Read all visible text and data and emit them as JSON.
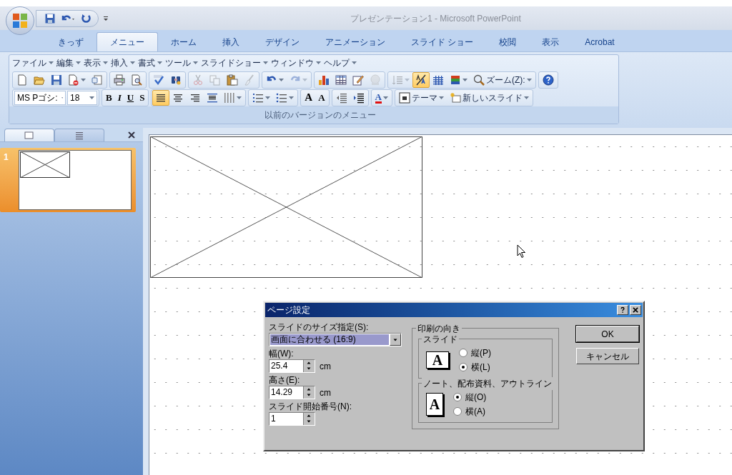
{
  "window": {
    "title": "プレゼンテーション1 - Microsoft PowerPoint"
  },
  "tabs": [
    {
      "label": "きっず",
      "selected": false
    },
    {
      "label": "メニュー",
      "selected": true
    },
    {
      "label": "ホーム",
      "selected": false
    },
    {
      "label": "挿入",
      "selected": false
    },
    {
      "label": "デザイン",
      "selected": false
    },
    {
      "label": "アニメーション",
      "selected": false
    },
    {
      "label": "スライド ショー",
      "selected": false
    },
    {
      "label": "校閲",
      "selected": false
    },
    {
      "label": "表示",
      "selected": false
    },
    {
      "label": "Acrobat",
      "selected": false
    }
  ],
  "classic_menu": {
    "menu_items": [
      "ファイル",
      "編集",
      "表示",
      "挿入",
      "書式",
      "ツール",
      "スライドショー",
      "ウィンドウ",
      "ヘルプ"
    ],
    "standard_toolbar": [
      [
        {
          "kind": "icon",
          "selected": false,
          "disabled": false,
          "dropdown": false
        },
        {
          "kind": "icon",
          "selected": false,
          "disabled": false,
          "dropdown": false
        },
        {
          "kind": "icon",
          "selected": false,
          "disabled": false,
          "dropdown": false
        },
        {
          "kind": "icon",
          "selected": false,
          "disabled": false,
          "dropdown": true
        },
        {
          "kind": "icon",
          "selected": false,
          "disabled": false,
          "dropdown": false
        }
      ],
      [
        {
          "kind": "icon",
          "selected": false,
          "disabled": false,
          "dropdown": false
        },
        {
          "kind": "icon",
          "selected": false,
          "disabled": false,
          "dropdown": false
        }
      ],
      [
        {
          "kind": "icon",
          "selected": false,
          "disabled": false,
          "dropdown": false
        },
        {
          "kind": "icon",
          "selected": false,
          "disabled": false,
          "dropdown": false
        }
      ],
      [
        {
          "kind": "icon",
          "selected": false,
          "disabled": true,
          "dropdown": false
        },
        {
          "kind": "icon",
          "selected": false,
          "disabled": true,
          "dropdown": false
        },
        {
          "kind": "icon",
          "selected": false,
          "disabled": false,
          "dropdown": false
        },
        {
          "kind": "icon",
          "selected": false,
          "disabled": true,
          "dropdown": false
        }
      ],
      [
        {
          "kind": "icon",
          "selected": false,
          "disabled": false,
          "dropdown": true
        },
        {
          "kind": "icon",
          "selected": false,
          "disabled": true,
          "dropdown": true
        }
      ],
      [
        {
          "kind": "icon",
          "selected": false,
          "disabled": false,
          "dropdown": false
        },
        {
          "kind": "icon",
          "selected": false,
          "disabled": false,
          "dropdown": false
        },
        {
          "kind": "icon",
          "selected": false,
          "disabled": false,
          "dropdown": false
        },
        {
          "kind": "icon",
          "selected": false,
          "disabled": true,
          "dropdown": false
        }
      ],
      [
        {
          "kind": "icon",
          "selected": false,
          "disabled": true,
          "dropdown": true
        },
        {
          "kind": "icon",
          "selected": true,
          "disabled": false,
          "dropdown": false
        },
        {
          "kind": "icon",
          "selected": false,
          "disabled": false,
          "dropdown": false
        },
        {
          "kind": "icon",
          "selected": false,
          "disabled": false,
          "dropdown": true
        },
        {
          "kind": "icon_label",
          "label": "ズーム(Z):",
          "selected": false,
          "disabled": false,
          "dropdown": true
        }
      ],
      [
        {
          "kind": "icon",
          "selected": false,
          "disabled": false,
          "dropdown": false
        }
      ]
    ],
    "formatting_toolbar": [
      [
        {
          "kind": "combo",
          "label": "MS Pゴシ:"
        },
        {
          "kind": "combo",
          "label": "18"
        }
      ],
      [
        {
          "kind": "letter",
          "label": "B",
          "selected": false
        },
        {
          "kind": "letter",
          "label": "I",
          "selected": false
        },
        {
          "kind": "letter",
          "label": "U",
          "selected": false
        },
        {
          "kind": "letter",
          "label": "S",
          "selected": false
        }
      ],
      [
        {
          "kind": "icon",
          "selected": true
        },
        {
          "kind": "icon",
          "selected": false
        },
        {
          "kind": "icon",
          "selected": false
        },
        {
          "kind": "icon",
          "selected": false
        },
        {
          "kind": "icon",
          "selected": false,
          "dropdown": true
        }
      ],
      [
        {
          "kind": "icon",
          "selected": false,
          "dropdown": true
        },
        {
          "kind": "icon",
          "selected": false,
          "dropdown": true
        }
      ],
      [
        {
          "kind": "letter",
          "label": "A",
          "selected": false
        },
        {
          "kind": "letter",
          "label": "A",
          "selected": false
        }
      ],
      [
        {
          "kind": "icon",
          "selected": false
        },
        {
          "kind": "icon",
          "selected": false
        }
      ],
      [
        {
          "kind": "letter",
          "label": "A",
          "selected": false,
          "dropdown": true
        }
      ],
      [
        {
          "kind": "icon_label",
          "label": "テーマ",
          "selected": false,
          "dropdown": true
        },
        {
          "kind": "icon_label",
          "label": "新しいスライド",
          "selected": false,
          "dropdown": true
        }
      ]
    ],
    "group_label": "以前のバージョンのメニュー"
  },
  "slides_panel": {
    "tabs": [
      {
        "selected": true
      },
      {
        "selected": false
      }
    ],
    "slides": [
      {
        "number": "1",
        "selected": true
      }
    ]
  },
  "dialog": {
    "title": "ページ設定",
    "size_label": "スライドのサイズ指定(S):",
    "size_value": "画面に合わせる (16:9)",
    "width_label": "幅(W):",
    "width_value": "25.4",
    "width_unit": "cm",
    "height_label": "高さ(E):",
    "height_value": "14.29",
    "height_unit": "cm",
    "start_label": "スライド開始番号(N):",
    "start_value": "1",
    "orientation_title": "印刷の向き",
    "orientation_groups": [
      {
        "title": "スライド",
        "icon_letter": "A",
        "options": [
          {
            "label": "縦(P)",
            "selected": false
          },
          {
            "label": "横(L)",
            "selected": true
          }
        ]
      },
      {
        "title": "ノート、配布資料、アウトライン",
        "icon_letter": "A",
        "options": [
          {
            "label": "縦(O)",
            "selected": true
          },
          {
            "label": "横(A)",
            "selected": false
          }
        ]
      }
    ],
    "buttons": [
      "OK",
      "キャンセル"
    ]
  }
}
